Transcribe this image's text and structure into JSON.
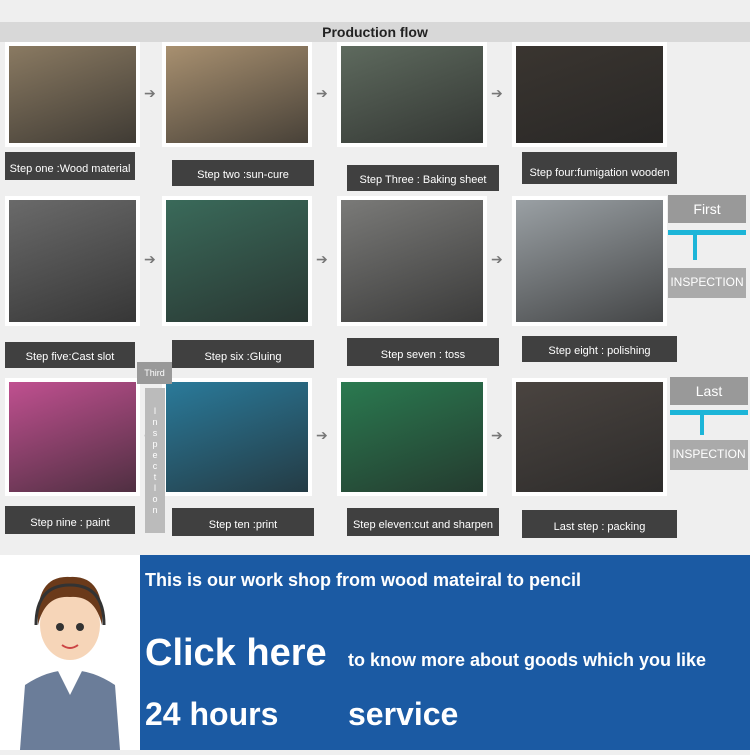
{
  "title": "Production flow",
  "steps": [
    {
      "label": "Step one :Wood material",
      "color": "#8a7a62"
    },
    {
      "label": "Step two :sun-cure",
      "color": "#a89070"
    },
    {
      "label": "Step Three : Baking sheet",
      "color": "#5e6a5e"
    },
    {
      "label": "Step four:fumigation wooden",
      "color": "#3a3530"
    },
    {
      "label": "Step five:Cast slot",
      "color": "#6a6a6a"
    },
    {
      "label": "Step six :Gluing",
      "color": "#3a6a5a"
    },
    {
      "label": "Step seven : toss",
      "color": "#7a7a78"
    },
    {
      "label": "Step eight : polishing",
      "color": "#9aa0a4"
    },
    {
      "label": "Step nine : paint",
      "color": "#c05090"
    },
    {
      "label": "Step ten :print",
      "color": "#2a7a9a"
    },
    {
      "label": "Step eleven:cut and sharpen",
      "color": "#2a7a50"
    },
    {
      "label": "Last step : packing",
      "color": "#4a4440"
    }
  ],
  "inspections": {
    "first": "First",
    "first_label": "INSPECTION",
    "third": "Third",
    "third_vertical": [
      "I",
      "n",
      "s",
      "p",
      "e",
      "c",
      "t",
      "I",
      "o",
      "n"
    ],
    "last": "Last",
    "last_label": "INSPECTION"
  },
  "banner": {
    "line1": "This is our work shop  from wood mateiral to pencil",
    "click": "Click  here",
    "click_sub": "to know  more  about  goods which you like",
    "hours": "24  hours",
    "service": "service"
  }
}
